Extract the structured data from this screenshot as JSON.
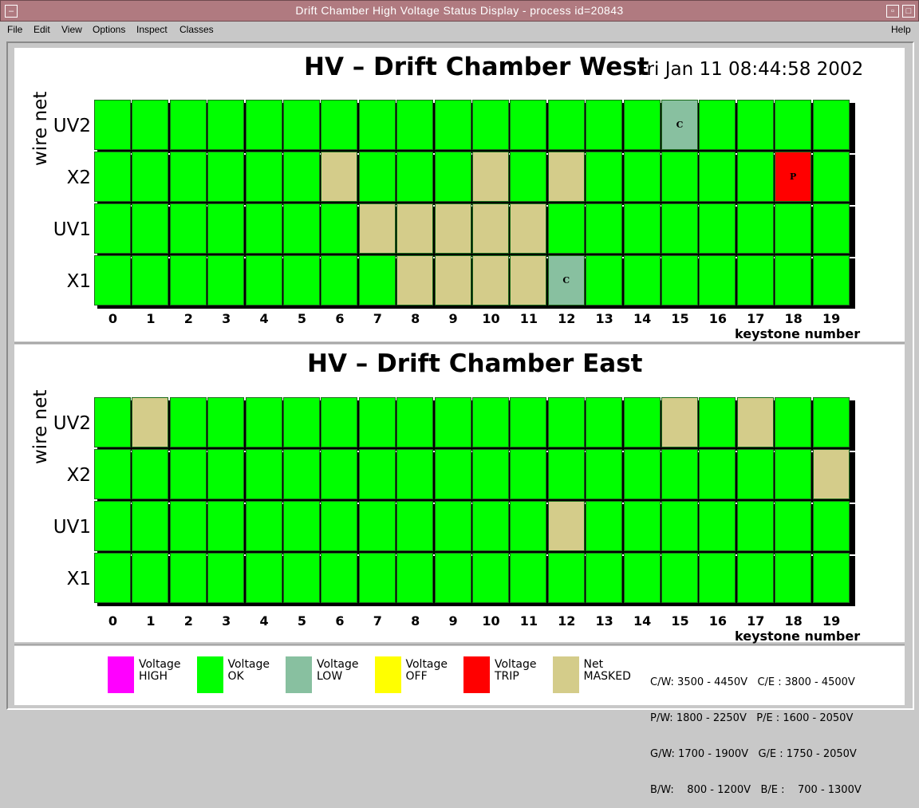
{
  "window": {
    "title": "Drift Chamber High Voltage Status Display - process id=20843"
  },
  "menubar": {
    "items": [
      {
        "label": "File",
        "id": "file"
      },
      {
        "label": "Edit",
        "id": "edit"
      },
      {
        "label": "View",
        "id": "view"
      },
      {
        "label": "Options",
        "id": "options"
      },
      {
        "label": "Inspect",
        "id": "inspect"
      },
      {
        "label": "Classes",
        "id": "classes"
      }
    ],
    "help": "Help"
  },
  "colors": {
    "ok": "#00ff00",
    "low": "#88c0a0",
    "trip": "#ff0000",
    "masked": "#d4cc8a",
    "high": "#ff00ff",
    "off": "#ffff00"
  },
  "west": {
    "title": "HV – Drift Chamber West",
    "timestamp": "Fri Jan 11 08:44:58 2002",
    "y_title": "wire net",
    "x_title": "keystone number",
    "rows": [
      "UV2",
      "X2",
      "UV1",
      "X1"
    ],
    "keystones": [
      "0",
      "1",
      "2",
      "3",
      "4",
      "5",
      "6",
      "7",
      "8",
      "9",
      "10",
      "11",
      "12",
      "13",
      "14",
      "15",
      "16",
      "17",
      "18",
      "19"
    ],
    "status": [
      [
        "ok",
        "ok",
        "ok",
        "ok",
        "ok",
        "ok",
        "ok",
        "ok",
        "ok",
        "ok",
        "ok",
        "ok",
        "ok",
        "ok",
        "ok",
        "low",
        "ok",
        "ok",
        "ok",
        "ok"
      ],
      [
        "ok",
        "ok",
        "ok",
        "ok",
        "ok",
        "ok",
        "masked",
        "ok",
        "ok",
        "ok",
        "masked",
        "ok",
        "masked",
        "ok",
        "ok",
        "ok",
        "ok",
        "ok",
        "trip",
        "ok"
      ],
      [
        "ok",
        "ok",
        "ok",
        "ok",
        "ok",
        "ok",
        "ok",
        "masked",
        "masked",
        "masked",
        "masked",
        "masked",
        "ok",
        "ok",
        "ok",
        "ok",
        "ok",
        "ok",
        "ok",
        "ok"
      ],
      [
        "ok",
        "ok",
        "ok",
        "ok",
        "ok",
        "ok",
        "ok",
        "ok",
        "masked",
        "masked",
        "masked",
        "masked",
        "low",
        "ok",
        "ok",
        "ok",
        "ok",
        "ok",
        "ok",
        "ok"
      ]
    ],
    "marks": [
      {
        "row": 0,
        "col": 15,
        "text": "C"
      },
      {
        "row": 1,
        "col": 18,
        "text": "P"
      },
      {
        "row": 3,
        "col": 12,
        "text": "C"
      }
    ]
  },
  "east": {
    "title": "HV – Drift Chamber East",
    "y_title": "wire net",
    "x_title": "keystone number",
    "rows": [
      "UV2",
      "X2",
      "UV1",
      "X1"
    ],
    "keystones": [
      "0",
      "1",
      "2",
      "3",
      "4",
      "5",
      "6",
      "7",
      "8",
      "9",
      "10",
      "11",
      "12",
      "13",
      "14",
      "15",
      "16",
      "17",
      "18",
      "19"
    ],
    "status": [
      [
        "ok",
        "masked",
        "ok",
        "ok",
        "ok",
        "ok",
        "ok",
        "ok",
        "ok",
        "ok",
        "ok",
        "ok",
        "ok",
        "ok",
        "ok",
        "masked",
        "ok",
        "masked",
        "ok",
        "ok"
      ],
      [
        "ok",
        "ok",
        "ok",
        "ok",
        "ok",
        "ok",
        "ok",
        "ok",
        "ok",
        "ok",
        "ok",
        "ok",
        "ok",
        "ok",
        "ok",
        "ok",
        "ok",
        "ok",
        "ok",
        "masked"
      ],
      [
        "ok",
        "ok",
        "ok",
        "ok",
        "ok",
        "ok",
        "ok",
        "ok",
        "ok",
        "ok",
        "ok",
        "ok",
        "masked",
        "ok",
        "ok",
        "ok",
        "ok",
        "ok",
        "ok",
        "ok"
      ],
      [
        "ok",
        "ok",
        "ok",
        "ok",
        "ok",
        "ok",
        "ok",
        "ok",
        "ok",
        "ok",
        "ok",
        "ok",
        "ok",
        "ok",
        "ok",
        "ok",
        "ok",
        "ok",
        "ok",
        "ok"
      ]
    ],
    "marks": []
  },
  "legend": {
    "items": [
      {
        "line1": "Voltage",
        "line2": "HIGH",
        "color": "#ff00ff"
      },
      {
        "line1": "Voltage",
        "line2": "OK",
        "color": "#00ff00"
      },
      {
        "line1": "Voltage",
        "line2": "LOW",
        "color": "#88c0a0"
      },
      {
        "line1": "Voltage",
        "line2": "OFF",
        "color": "#ffff00"
      },
      {
        "line1": "Voltage",
        "line2": "TRIP",
        "color": "#ff0000"
      },
      {
        "line1": "Net",
        "line2": "MASKED",
        "color": "#d4cc8a"
      }
    ],
    "ranges": [
      "C/W: 3500 - 4450V   C/E : 3800 - 4500V",
      "P/W: 1800 - 2250V   P/E : 1600 - 2050V",
      "G/W: 1700 - 1900V   G/E : 1750 - 2050V",
      "B/W:    800 - 1200V   B/E :    700 - 1300V"
    ]
  }
}
